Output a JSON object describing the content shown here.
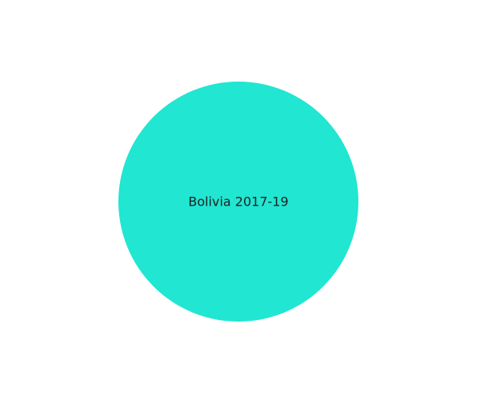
{
  "chart_data": {
    "type": "pie",
    "slices": [
      {
        "label": "Bolivia 2017-19",
        "value": 100,
        "color": "#20E6D2"
      }
    ]
  }
}
